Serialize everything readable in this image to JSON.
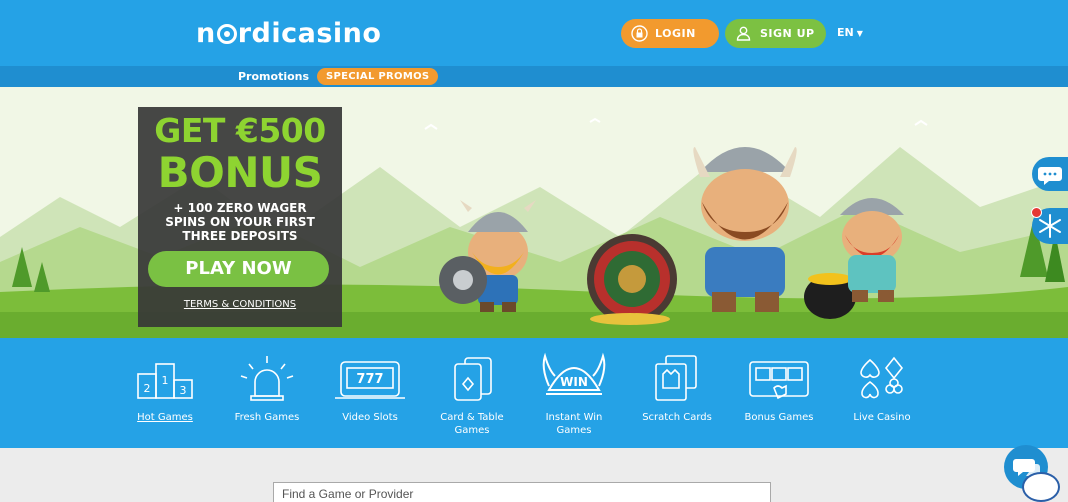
{
  "header": {
    "logo_text": "nordicasino",
    "login_label": "LOGIN",
    "signup_label": "SIGN UP",
    "language": "EN",
    "colors": {
      "header_bg": "#25a2e6",
      "login": "#f29a2e",
      "signup": "#7cc142"
    }
  },
  "subnav": {
    "promotions_label": "Promotions",
    "special_label": "SPECIAL PROMOS"
  },
  "banner": {
    "line1": "GET €500",
    "line2": "BONUS",
    "sub_lines": [
      "+ 100 ZERO WAGER",
      "SPINS ON YOUR FIRST",
      "THREE DEPOSITS"
    ],
    "cta_label": "PLAY NOW",
    "terms_label": "TERMS & CONDITIONS"
  },
  "categories": [
    {
      "label": "Hot Games",
      "icon": "podium-icon"
    },
    {
      "label": "Fresh Games",
      "icon": "siren-icon"
    },
    {
      "label": "Video Slots",
      "icon": "slot-machine-icon"
    },
    {
      "label": "Card & Table Games",
      "icon": "cards-icon"
    },
    {
      "label": "Instant Win Games",
      "icon": "viking-helmet-icon"
    },
    {
      "label": "Scratch Cards",
      "icon": "scratch-card-icon"
    },
    {
      "label": "Bonus Games",
      "icon": "bonus-screen-icon"
    },
    {
      "label": "Live Casino",
      "icon": "card-suits-icon"
    }
  ],
  "search": {
    "placeholder": "Find a Game or Provider"
  },
  "hot_games_slot_digits": [
    "1",
    "2",
    "3"
  ],
  "slot_text": "777",
  "win_text": "WIN"
}
